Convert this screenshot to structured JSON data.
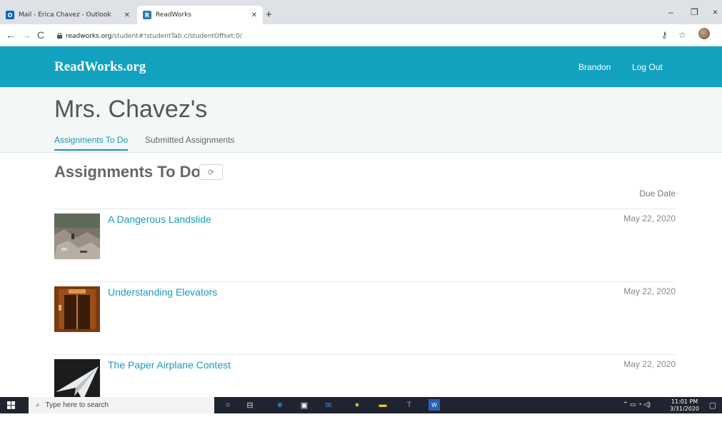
{
  "browser": {
    "tabs": [
      {
        "title": "Mail - Erica Chavez - Outlook",
        "icon": "outlook-icon",
        "active": false
      },
      {
        "title": "ReadWorks",
        "icon": "readworks-icon",
        "active": true
      }
    ],
    "new_tab": "+",
    "url_host": "readworks.org",
    "url_path": "/student#!studentTab:c/studentOffset:0/",
    "window_controls": {
      "minimize": "–",
      "restore": "❐",
      "close": "×"
    }
  },
  "header": {
    "logo": "ReadWorks.org",
    "user": "Brandon",
    "logout": "Log Out"
  },
  "class": {
    "title": "Mrs. Chavez's",
    "tabs": [
      {
        "label": "Assignments To Do",
        "active": true
      },
      {
        "label": "Submitted Assignments",
        "active": false
      }
    ]
  },
  "assignments": {
    "heading": "Assignments To Do",
    "refresh_glyph": "⟳",
    "due_header": "Due Date",
    "items": [
      {
        "title": "A Dangerous Landslide",
        "due": "May 22, 2020",
        "thumb": "landslide"
      },
      {
        "title": "Understanding Elevators",
        "due": "May 22, 2020",
        "thumb": "elevator"
      },
      {
        "title": "The Paper Airplane Contest",
        "due": "May 22, 2020",
        "thumb": "airplane"
      }
    ]
  },
  "taskbar": {
    "search_placeholder": "Type here to search",
    "time": "11:01 PM",
    "date": "3/31/2020"
  },
  "colors": {
    "brand": "#12a2c0",
    "link": "#1e9ab8"
  }
}
